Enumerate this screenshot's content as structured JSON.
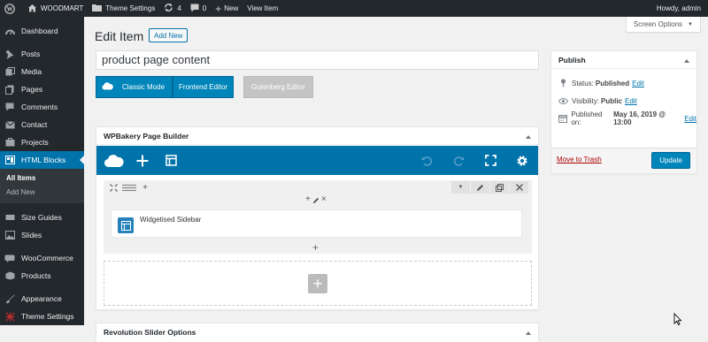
{
  "adminbar": {
    "site_name": "WOODMART",
    "theme_settings": "Theme Settings",
    "updates_count": "4",
    "comments_count": "0",
    "new_label": "New",
    "view_item": "View Item",
    "howdy": "Howdy, admin"
  },
  "sidebar": {
    "items": [
      {
        "label": "Dashboard",
        "icon": "dashboard-icon"
      },
      {
        "label": "Posts",
        "icon": "pin-icon"
      },
      {
        "label": "Media",
        "icon": "media-icon"
      },
      {
        "label": "Pages",
        "icon": "pages-icon"
      },
      {
        "label": "Comments",
        "icon": "comment-icon"
      },
      {
        "label": "Contact",
        "icon": "mail-icon"
      },
      {
        "label": "Projects",
        "icon": "projects-icon"
      },
      {
        "label": "HTML Blocks",
        "icon": "blocks-icon"
      },
      {
        "label": "Size Guides",
        "icon": "size-guides-icon"
      },
      {
        "label": "Slides",
        "icon": "slides-icon"
      },
      {
        "label": "WooCommerce",
        "icon": "woocommerce-icon"
      },
      {
        "label": "Products",
        "icon": "products-icon"
      },
      {
        "label": "Appearance",
        "icon": "brush-icon"
      },
      {
        "label": "Theme Settings",
        "icon": "theme-settings-icon"
      }
    ],
    "submenu": [
      "All Items",
      "Add New"
    ]
  },
  "main": {
    "screen_options": "Screen Options",
    "page_title": "Edit Item",
    "add_new": "Add New",
    "title_value": "product page content",
    "classic_mode": "Classic Mode",
    "frontend_editor": "Frontend Editor",
    "gutenberg_editor": "Gutenberg Editor",
    "wpbakery_title": "WPBakery Page Builder",
    "element_label": "Widgetised Sidebar",
    "revolution_title": "Revolution Slider Options"
  },
  "publish": {
    "title": "Publish",
    "status_label": "Status: ",
    "status_value": "Published",
    "visibility_label": "Visibility: ",
    "visibility_value": "Public",
    "published_on_label": "Published on: ",
    "published_on_value": "May 16, 2019 @ 13:00",
    "edit": "Edit",
    "trash": "Move to Trash",
    "update": "Update"
  },
  "colors": {
    "admin_bar": "#23282d",
    "accent_blue": "#0073aa",
    "button_blue": "#0085ba"
  }
}
